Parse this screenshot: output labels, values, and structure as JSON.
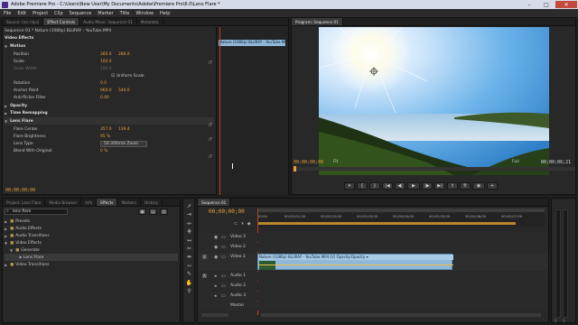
{
  "window": {
    "title": "Adobe Premiere Pro - C:\\Users\\New User\\My Documents\\Adobe\\Premiere Pro\\6.0\\Lens Flare *",
    "minimize": "–",
    "maximize": "□",
    "close": "✕"
  },
  "menu": [
    "File",
    "Edit",
    "Project",
    "Clip",
    "Sequence",
    "Marker",
    "Title",
    "Window",
    "Help"
  ],
  "effect_controls": {
    "tabs": [
      "Source: (no clips)",
      "Effect Controls",
      "Audio Mixer: Sequence 01",
      "Metadata"
    ],
    "sequence_label": "Sequence 01 * Nature (1080p) BLURAY - YouTube.MP4",
    "section": "Video Effects",
    "clip_bar": "Nature (1080p) BLURAY - YouTube.MP4",
    "rows": {
      "motion": "Motion",
      "position": {
        "label": "Position",
        "v1": "360.0",
        "v2": "288.0"
      },
      "scale": {
        "label": "Scale",
        "v": "100.0"
      },
      "scale_width": {
        "label": "Scale Width",
        "v": "100.0"
      },
      "uniform_scale": "Uniform Scale",
      "rotation": {
        "label": "Rotation",
        "v": "0.0"
      },
      "anchor": {
        "label": "Anchor Point",
        "v1": "960.0",
        "v2": "540.0"
      },
      "antiflicker": {
        "label": "Anti-flicker Filter",
        "v": "0.00"
      },
      "opacity": "Opacity",
      "time_remap": "Time Remapping",
      "lens_flare": "Lens Flare",
      "flare_center": {
        "label": "Flare Center",
        "v1": "357.0",
        "v2": "139.4"
      },
      "flare_brightness": {
        "label": "Flare Brightness",
        "v": "95 %"
      },
      "lens_type": {
        "label": "Lens Type",
        "v": "50-300mm Zoom"
      },
      "blend": {
        "label": "Blend With Original",
        "v": "0 %"
      }
    },
    "timecode": "00;00;00;00"
  },
  "program": {
    "tab": "Program: Sequence 01",
    "timecode": "00;00;00;00",
    "fit": "Fit",
    "quality": "Full",
    "duration": "00;00;06;21"
  },
  "project": {
    "tabs": [
      "Project: Lens Flare",
      "Media Browser",
      "Info",
      "Effects",
      "Markers",
      "History"
    ],
    "search": "lens flare",
    "tree": [
      {
        "label": "Presets",
        "indent": 0
      },
      {
        "label": "Audio Effects",
        "indent": 0
      },
      {
        "label": "Audio Transitions",
        "indent": 0
      },
      {
        "label": "Video Effects",
        "indent": 0
      },
      {
        "label": "Generate",
        "indent": 1
      },
      {
        "label": "Lens Flare",
        "indent": 2
      },
      {
        "label": "Video Transitions",
        "indent": 0
      }
    ]
  },
  "timeline": {
    "tab": "Sequence 01",
    "timecode": "00;00;00;00",
    "ruler": [
      "00;00",
      "00;00;01;00",
      "00;00;02;00",
      "00;00;03;00",
      "00;00;04;00",
      "00;00;05;00",
      "00;00;06;00",
      "00;00;07;00"
    ],
    "tracks": [
      {
        "name": "Video 3",
        "kind": "video"
      },
      {
        "name": "Video 2",
        "kind": "video"
      },
      {
        "name": "Video 1",
        "kind": "video"
      },
      {
        "name": "Audio 1",
        "kind": "audio"
      },
      {
        "name": "Audio 2",
        "kind": "audio"
      },
      {
        "name": "Audio 3",
        "kind": "audio"
      },
      {
        "name": "Master",
        "kind": "master"
      }
    ],
    "clip": "Nature (1080p) BLURAY - YouTube.MP4 [V] Opacity:Opacity ▾"
  },
  "colors": {
    "accent": "#e8a13a",
    "clip": "#8fb8d9",
    "titlebar": "#d6dbe9"
  }
}
